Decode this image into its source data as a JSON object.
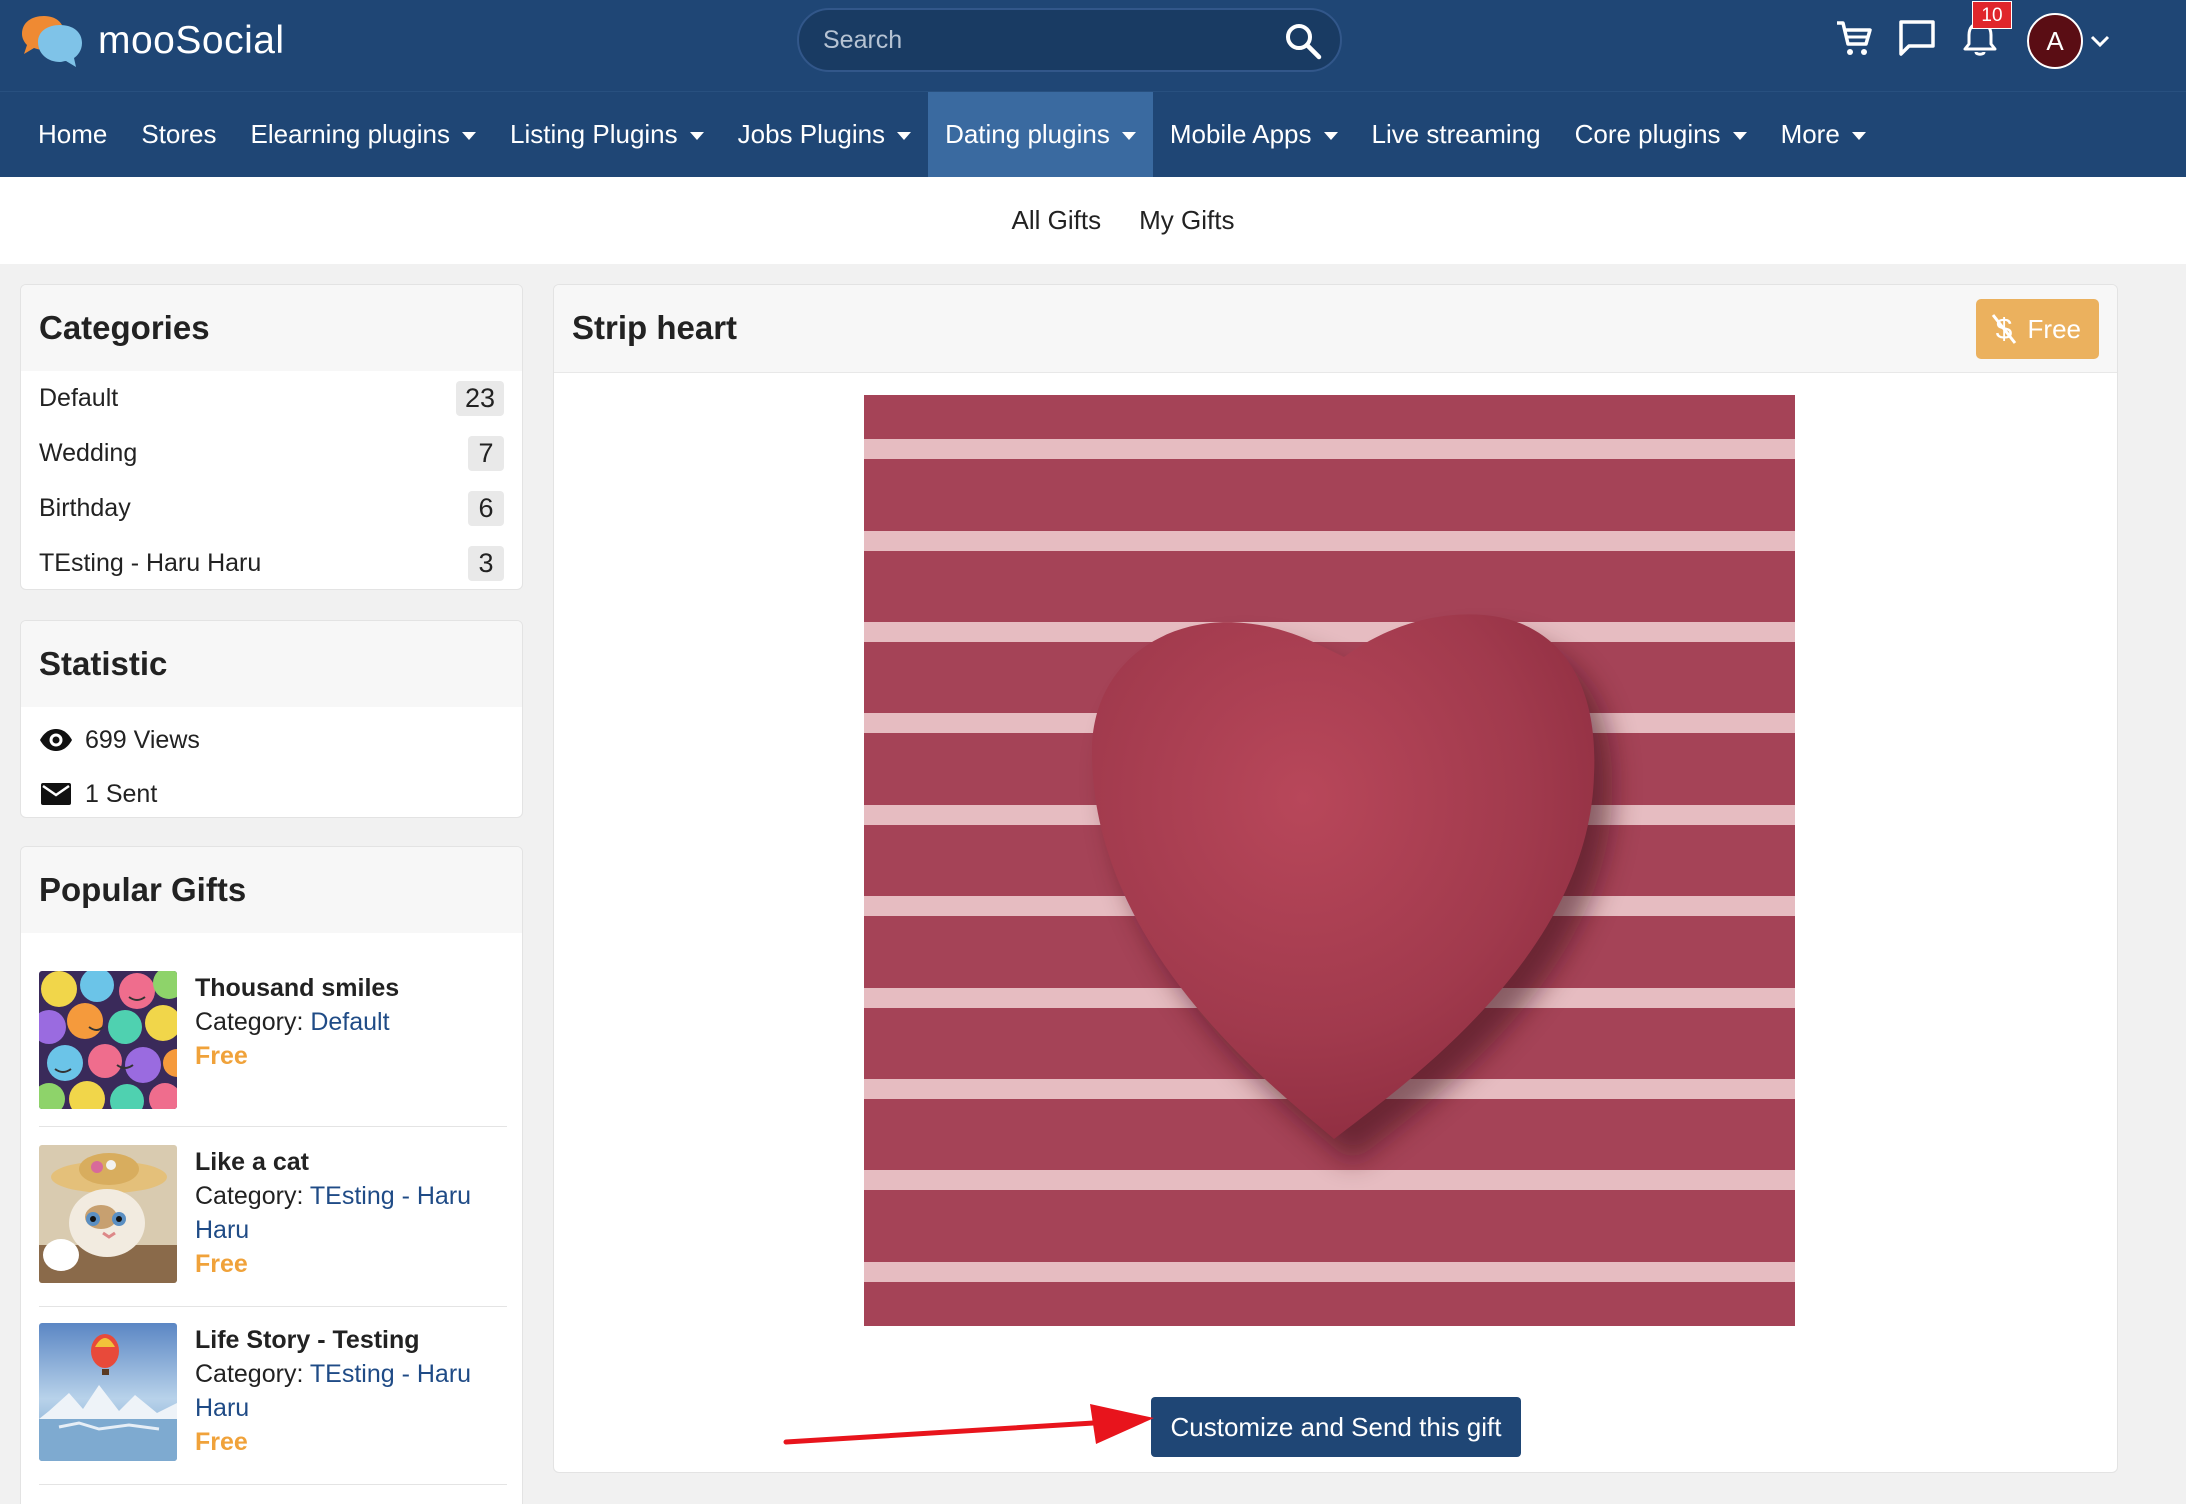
{
  "app": {
    "name": "mooSocial",
    "notification_count": "10",
    "avatar_letter": "A"
  },
  "colors": {
    "brand": "#1f4675",
    "nav_active": "#3a6aa0",
    "free_accent": "#ebb15e",
    "price_text": "#f0a23a",
    "link": "#1f4b86",
    "badge": "#e0262b"
  },
  "search": {
    "placeholder": "Search",
    "icon": "search-icon"
  },
  "nav": {
    "items": [
      {
        "label": "Home",
        "dropdown": false,
        "active": false
      },
      {
        "label": "Stores",
        "dropdown": false,
        "active": false
      },
      {
        "label": "Elearning plugins",
        "dropdown": true,
        "active": false
      },
      {
        "label": "Listing Plugins",
        "dropdown": true,
        "active": false
      },
      {
        "label": "Jobs Plugins",
        "dropdown": true,
        "active": false
      },
      {
        "label": "Dating plugins",
        "dropdown": true,
        "active": true
      },
      {
        "label": "Mobile Apps",
        "dropdown": true,
        "active": false
      },
      {
        "label": "Live streaming",
        "dropdown": false,
        "active": false
      },
      {
        "label": "Core plugins",
        "dropdown": true,
        "active": false
      },
      {
        "label": "More",
        "dropdown": true,
        "active": false
      }
    ]
  },
  "subnav": {
    "items": [
      {
        "label": "All Gifts"
      },
      {
        "label": "My Gifts"
      }
    ]
  },
  "categories": {
    "title": "Categories",
    "items": [
      {
        "label": "Default",
        "count": "23"
      },
      {
        "label": "Wedding",
        "count": "7"
      },
      {
        "label": "Birthday",
        "count": "6"
      },
      {
        "label": "TEsting - Haru Haru",
        "count": "3"
      }
    ]
  },
  "statistic": {
    "title": "Statistic",
    "views": "699 Views",
    "sent": "1 Sent"
  },
  "popular": {
    "title": "Popular Gifts",
    "category_label": "Category:",
    "items": [
      {
        "title": "Thousand smiles",
        "category": "Default",
        "price": "Free"
      },
      {
        "title": "Like a cat",
        "category": "TEsting - Haru Haru",
        "price": "Free"
      },
      {
        "title": "Life Story - Testing",
        "category": "TEsting - Haru Haru",
        "price": "Free"
      }
    ]
  },
  "gift": {
    "title": "Strip heart",
    "price_label": "Free",
    "send_button": "Customize and Send this gift"
  }
}
